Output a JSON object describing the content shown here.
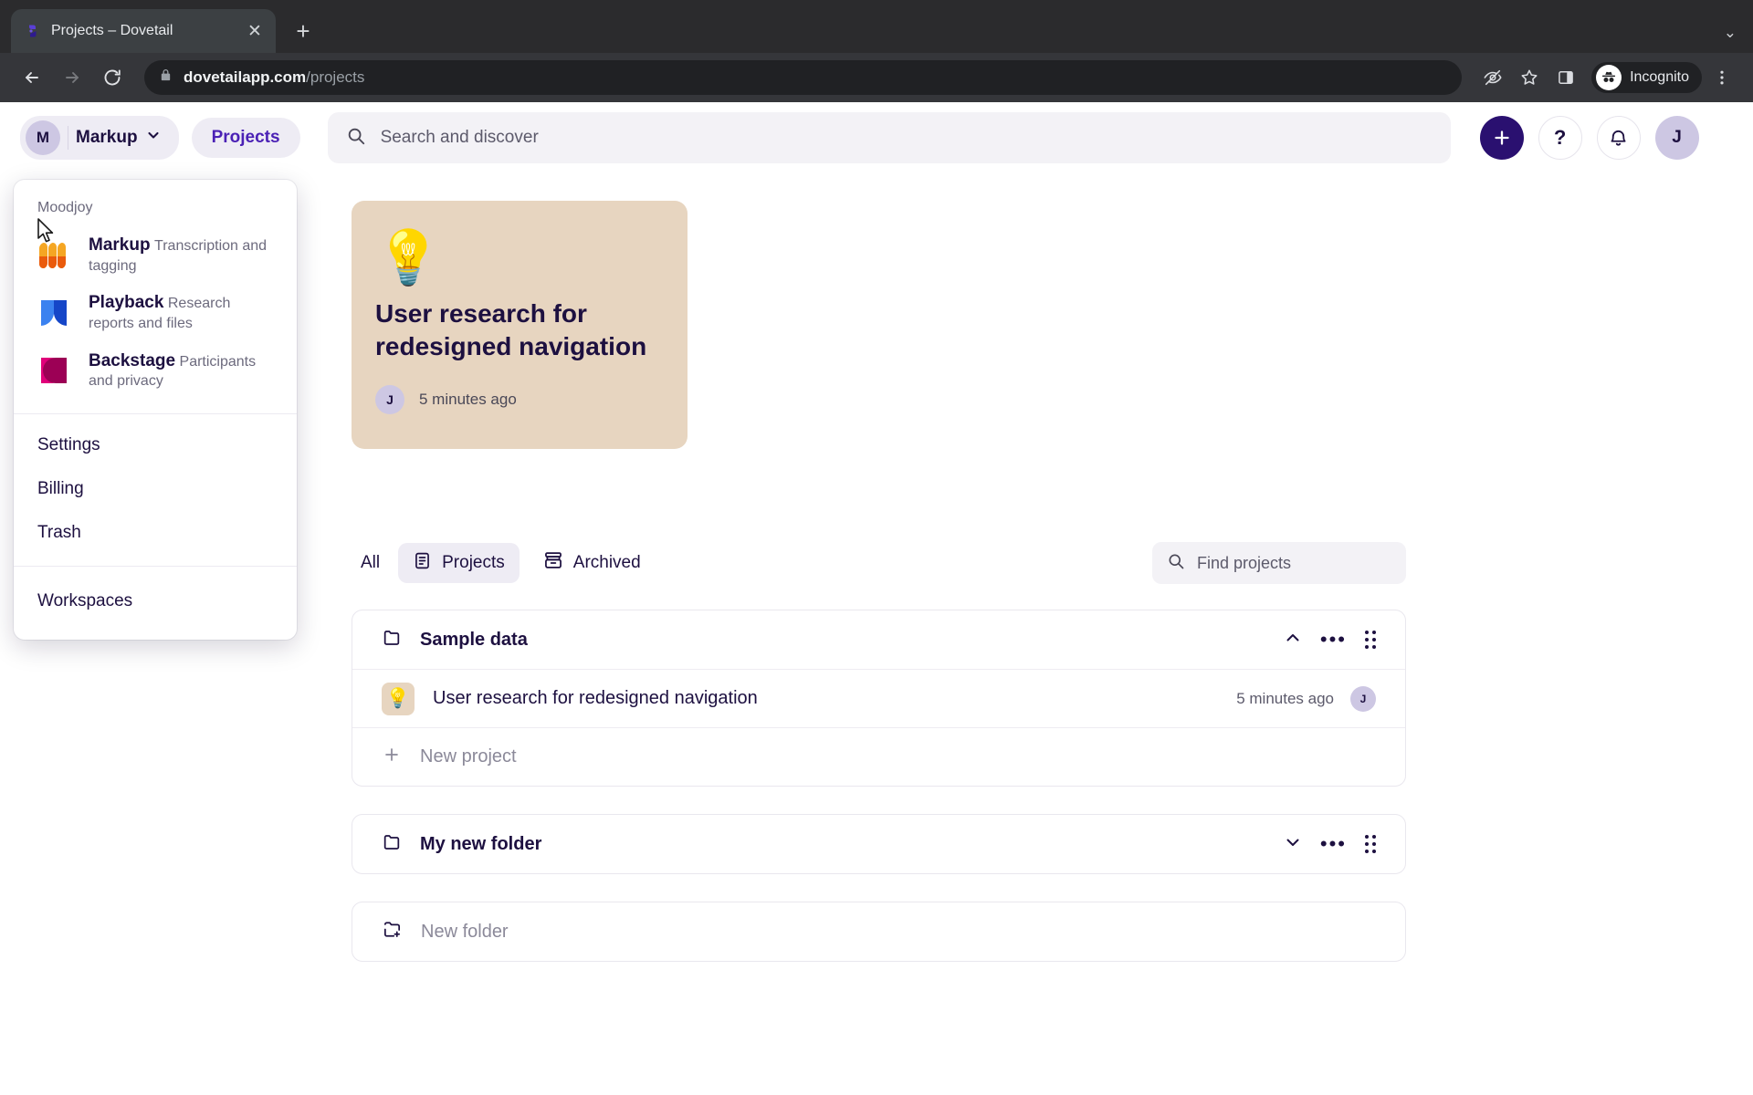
{
  "browser": {
    "tab": {
      "title": "Projects – Dovetail",
      "favicon": "dovetail-logo-icon",
      "close_icon": "close-icon"
    },
    "new_tab_icon": "plus-icon",
    "tabstrip_menu_icon": "chevron-down-icon",
    "back_icon": "back-arrow-icon",
    "forward_icon": "forward-arrow-icon",
    "reload_icon": "reload-icon",
    "lock_icon": "lock-icon",
    "url_host": "dovetailapp.com",
    "url_path": "/projects",
    "toolbar_icons": [
      "eye-slash-icon",
      "star-icon",
      "side-panel-icon"
    ],
    "incognito_label": "Incognito",
    "incognito_icon": "incognito-icon",
    "menu_icon": "three-dot-menu-icon"
  },
  "topbar": {
    "workspace_avatar": "M",
    "workspace_name": "Markup",
    "workspace_chevron": "chevron-down-icon",
    "projects_pill": "Projects",
    "search_placeholder": "Search and discover",
    "search_icon": "search-icon",
    "add_icon": "plus-icon",
    "help_label": "?",
    "notifications_icon": "bell-icon",
    "user_avatar": "J"
  },
  "menu": {
    "org_label": "Moodjoy",
    "apps": [
      {
        "name": "Markup",
        "desc": "Transcription and tagging",
        "icon": "markup-logo-icon"
      },
      {
        "name": "Playback",
        "desc": "Research reports and files",
        "icon": "playback-logo-icon"
      },
      {
        "name": "Backstage",
        "desc": "Participants and privacy",
        "icon": "backstage-logo-icon"
      }
    ],
    "items": [
      "Settings",
      "Billing",
      "Trash"
    ],
    "footer_item": "Workspaces"
  },
  "hero": {
    "emoji": "💡",
    "title": "User research for redesigned navigation",
    "avatar": "J",
    "time": "5 minutes ago",
    "bg_color": "#e7d5c0"
  },
  "filters": {
    "all": "All",
    "projects": "Projects",
    "projects_icon": "document-list-icon",
    "archived": "Archived",
    "archived_icon": "archive-box-icon",
    "find_placeholder": "Find projects",
    "find_icon": "search-icon"
  },
  "folders": [
    {
      "name": "Sample data",
      "folder_icon": "folder-icon",
      "collapse_icon": "chevron-up-icon",
      "more_icon": "more-horizontal-icon",
      "drag_icon": "drag-handle-icon",
      "expanded": true,
      "projects": [
        {
          "emoji": "💡",
          "name": "User research for redesigned navigation",
          "time": "5 minutes ago",
          "avatar": "J"
        }
      ],
      "new_project_label": "New project",
      "new_project_icon": "plus-icon"
    },
    {
      "name": "My new folder",
      "folder_icon": "folder-icon",
      "collapse_icon": "chevron-down-icon",
      "more_icon": "more-horizontal-icon",
      "drag_icon": "drag-handle-icon",
      "expanded": false,
      "projects": [],
      "new_project_label": "",
      "new_project_icon": ""
    }
  ],
  "new_folder": {
    "label": "New folder",
    "icon": "folder-plus-icon"
  },
  "colors": {
    "accent": "#4b21b5",
    "deep": "#2a1070",
    "ink": "#1d1040",
    "lilac": "#eeecf4",
    "avatar": "#cdc7e3"
  }
}
